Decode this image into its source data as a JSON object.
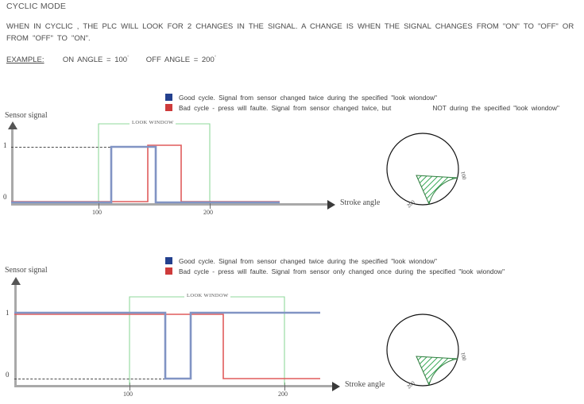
{
  "document": {
    "title": "CYCLIC MODE",
    "paragraph": "WHEN IN  CYCLIC , THE PLC WILL LOOK  FOR 2 CHANGES   IN THE SIGNAL.  A CHANGE   IS WHEN  THE SIGNAL  CHANGES   FROM  \"ON\"  TO \"OFF\"  OR FROM  \"OFF\"  TO \"ON\".",
    "example_label": "EXAMPLE:",
    "example_on_angle": "ON  ANGLE  = 100",
    "example_off_angle": "OFF  ANGLE  = 200",
    "degree_symbol": "°"
  },
  "colors": {
    "legend_blue": "#24408E",
    "legend_red": "#CE3B3B",
    "signal_blue": "#8194C4",
    "signal_red": "#E05B5B",
    "look_window_green": "#8FD99B",
    "wedge_green": "#34A853",
    "axis_gray": "#A9A9A9"
  },
  "charts": [
    {
      "id": "chart-1",
      "legend": [
        {
          "color_key": "legend_blue",
          "text": "Good  cycle. Signal  from  sensor   changed   twice during  the specified \"look  wiondow\"",
          "gap_after": null,
          "text_tail": null
        },
        {
          "color_key": "legend_red",
          "text": "Bad cycle - press will faulte. Signal from sensor changed twice, but",
          "gap_after": true,
          "text_tail": "NOT  during  the specified \"look  wiondow\""
        }
      ],
      "y_axis_title": "Sensor signal",
      "x_axis_title": "Stroke angle",
      "y_tick_labels": [
        "1",
        "0"
      ],
      "x_tick_labels": [
        "100",
        "200"
      ],
      "look_window_label": "LOOK WINDOW",
      "circle": {
        "start_label": "100",
        "end_label": "200"
      }
    },
    {
      "id": "chart-2",
      "legend": [
        {
          "color_key": "legend_blue",
          "text": "Good  cycle. Signal  from sensor  changed  twice during  the specified \"look  wiondow\"",
          "gap_after": null,
          "text_tail": null
        },
        {
          "color_key": "legend_red",
          "text": "Bad  cycle  -  press  will  faulte.  Signal  from  sensor  only  changed  once during  the specified \"look  wiondow\"",
          "gap_after": null,
          "text_tail": null
        }
      ],
      "y_axis_title": "Sensor signal",
      "x_axis_title": "Stroke angle",
      "y_tick_labels": [
        "1",
        "0"
      ],
      "x_tick_labels": [
        "100",
        "200"
      ],
      "look_window_label": "LOOK WINDOW",
      "circle": {
        "start_label": "100",
        "end_label": "200"
      }
    }
  ],
  "chart_data": [
    {
      "type": "line",
      "title": "Cyclic mode - good cycle vs bad cycle (both changes, one outside window)",
      "xlabel": "Stroke angle",
      "ylabel": "Sensor signal",
      "xlim": [
        60,
        380
      ],
      "ylim": [
        0,
        1
      ],
      "x_ticks": [
        100,
        200
      ],
      "y_ticks": [
        0,
        1
      ],
      "grid": false,
      "legend_position": "above",
      "annotations": [
        "LOOK WINDOW"
      ],
      "look_window": [
        100,
        200
      ],
      "series": [
        {
          "name": "Good cycle. Signal from sensor changed twice during the specified \"look wiondow\"",
          "color": "#8194C4",
          "type": "step",
          "x": [
            60,
            110,
            110,
            180,
            180,
            380
          ],
          "y": [
            0,
            0,
            1,
            1,
            0,
            0
          ]
        },
        {
          "name": "Bad cycle - press will faulte. Signal from sensor changed twice, but NOT during the specified \"look wiondow\"",
          "color": "#E05B5B",
          "type": "step",
          "x": [
            60,
            172,
            172,
            229,
            229,
            380
          ],
          "y": [
            0,
            0,
            1,
            1,
            0,
            0
          ]
        }
      ]
    },
    {
      "type": "line",
      "title": "Cyclic mode - good cycle vs bad cycle (only one change inside window)",
      "xlabel": "Stroke angle",
      "ylabel": "Sensor signal",
      "xlim": [
        20,
        330
      ],
      "ylim": [
        0,
        1
      ],
      "x_ticks": [
        100,
        200
      ],
      "y_ticks": [
        0,
        1
      ],
      "grid": false,
      "legend_position": "above",
      "annotations": [
        "LOOK WINDOW"
      ],
      "look_window": [
        100,
        200
      ],
      "series": [
        {
          "name": "Good cycle. Signal from sensor changed twice during the specified \"look wiondow\"",
          "color": "#8194C4",
          "type": "step",
          "x": [
            20,
            123,
            123,
            139,
            139,
            330
          ],
          "y": [
            1,
            1,
            0,
            0,
            1,
            1
          ]
        },
        {
          "name": "Bad cycle - press will faulte. Signal from sensor only changed once during the specified \"look wiondow\"",
          "color": "#E05B5B",
          "type": "step",
          "x": [
            20,
            160,
            160,
            330
          ],
          "y": [
            1,
            1,
            0,
            0
          ]
        }
      ]
    },
    {
      "type": "pie",
      "title": "Stroke angle wedge diagram (chart 1)",
      "labels": [
        "100",
        "200"
      ],
      "wedge_start_deg": 100,
      "wedge_end_deg": 200,
      "wedge_fill": "hatched green",
      "values": [
        100,
        260
      ]
    },
    {
      "type": "pie",
      "title": "Stroke angle wedge diagram (chart 2)",
      "labels": [
        "100",
        "200"
      ],
      "wedge_start_deg": 100,
      "wedge_end_deg": 200,
      "wedge_fill": "hatched green",
      "values": [
        100,
        260
      ]
    }
  ]
}
